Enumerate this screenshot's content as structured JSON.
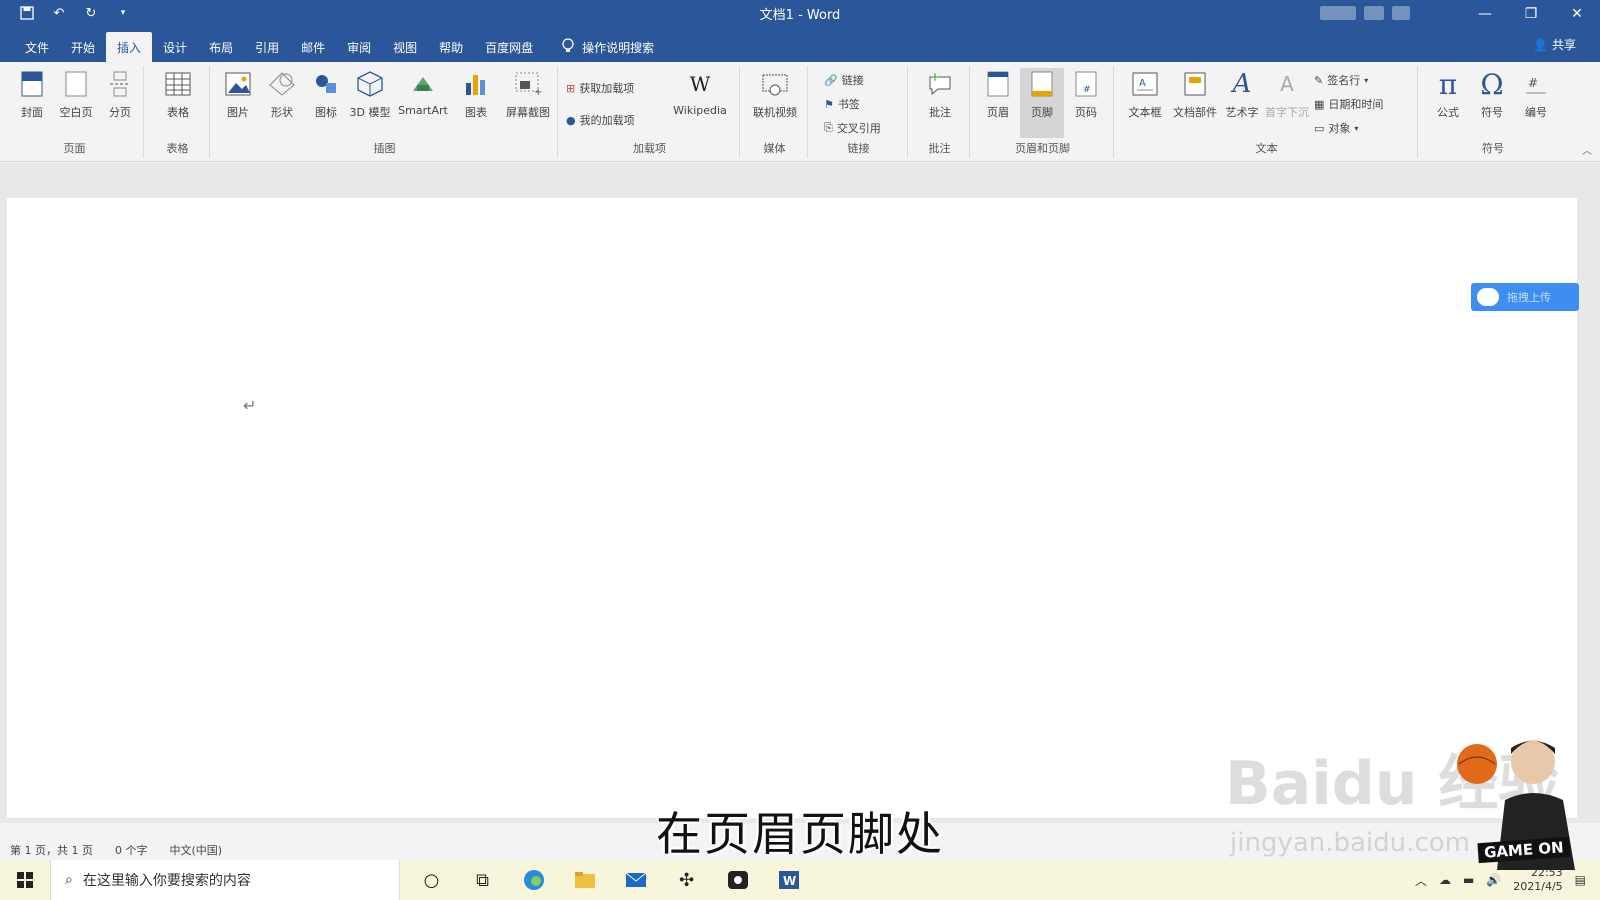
{
  "titlebar": {
    "title": "文档1 - Word",
    "quick_access": [
      "save-icon",
      "undo-icon",
      "redo-icon",
      "customize-icon"
    ],
    "window_buttons": [
      "minimize-icon",
      "restore-icon",
      "close-icon"
    ]
  },
  "tabs": [
    {
      "label": "文件"
    },
    {
      "label": "开始"
    },
    {
      "label": "插入",
      "active": true
    },
    {
      "label": "设计"
    },
    {
      "label": "布局"
    },
    {
      "label": "引用"
    },
    {
      "label": "邮件"
    },
    {
      "label": "审阅"
    },
    {
      "label": "视图"
    },
    {
      "label": "帮助"
    },
    {
      "label": "百度网盘"
    }
  ],
  "tell_me": {
    "text": "操作说明搜索"
  },
  "share": {
    "label": "共享"
  },
  "ribbon": {
    "pages": {
      "label": "页面",
      "cover": "封面",
      "blank": "空白页",
      "break": "分页"
    },
    "tables": {
      "label": "表格",
      "table": "表格"
    },
    "illustrations": {
      "label": "插图",
      "pictures": "图片",
      "shapes": "形状",
      "icons": "图标",
      "model3d": "3D 模型",
      "smartart": "SmartArt",
      "chart": "图表",
      "screenshot": "屏幕截图"
    },
    "addins": {
      "label": "加载项",
      "get": "获取加载项",
      "my": "我的加载项",
      "wikipedia": "Wikipedia"
    },
    "media": {
      "label": "媒体",
      "video": "联机视频"
    },
    "links": {
      "label": "链接",
      "link": "链接",
      "bookmark": "书签",
      "cross_ref": "交叉引用"
    },
    "comments": {
      "label": "批注",
      "comment": "批注"
    },
    "header_footer": {
      "label": "页眉和页脚",
      "header": "页眉",
      "footer": "页脚",
      "page_number": "页码"
    },
    "text": {
      "label": "文本",
      "textbox": "文本框",
      "quick_parts": "文档部件",
      "wordart": "艺术字",
      "dropcap": "首字下沉",
      "signature": "签名行",
      "datetime": "日期和时间",
      "object": "对象"
    },
    "symbols": {
      "label": "符号",
      "equation": "公式",
      "symbol": "符号",
      "number": "编号"
    }
  },
  "document": {
    "upload_button": "拖拽上传"
  },
  "status": {
    "page": "第 1 页，共 1 页",
    "words": "0 个字",
    "language": "中文(中国)"
  },
  "taskbar": {
    "search_placeholder": "在这里输入你要搜索的内容",
    "apps": [
      "cortana-icon",
      "task-view-icon",
      "edge-icon",
      "file-explorer-icon",
      "mail-icon",
      "pinwheel-icon",
      "camera-icon",
      "word-icon"
    ],
    "time": "22:53",
    "date": "2021/4/5"
  },
  "overlay": {
    "subtitle": "在页眉页脚处",
    "watermark": "Baidu 经验",
    "watermark_url": "jingyan.baidu.com",
    "streamer_logo": "GAME ON"
  },
  "colors": {
    "word_blue": "#2b579a",
    "ribbon_bg": "#f3f3f3",
    "taskbar_bg": "#f7f5dc",
    "upload_blue": "#3d8ef0"
  }
}
